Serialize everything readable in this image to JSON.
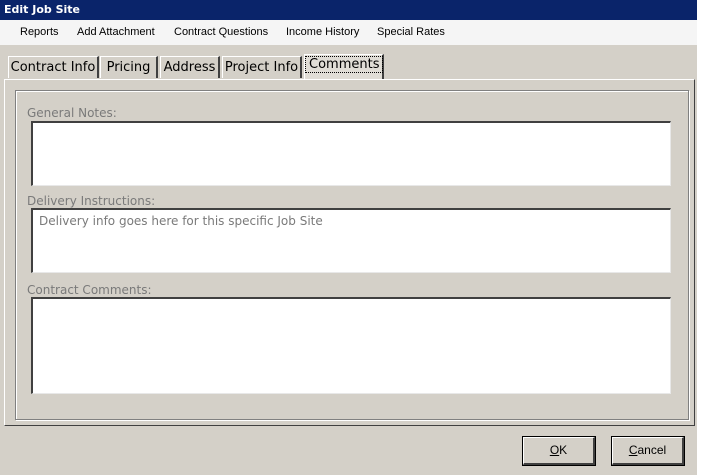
{
  "window": {
    "title": "Edit Job Site"
  },
  "menu": {
    "items": [
      "Reports",
      "Add Attachment",
      "Contract Questions",
      "Income History",
      "Special Rates"
    ]
  },
  "tabs": [
    {
      "label": "Contract Info"
    },
    {
      "label": "Pricing"
    },
    {
      "label": "Address"
    },
    {
      "label": "Project Info"
    },
    {
      "label": "Comments",
      "active": true
    }
  ],
  "form": {
    "general_notes": {
      "label": "General Notes:",
      "value": ""
    },
    "delivery_instructions": {
      "label": "Delivery Instructions:",
      "value": "Delivery info goes here for this specific Job Site"
    },
    "contract_comments": {
      "label": "Contract Comments:",
      "value": ""
    }
  },
  "buttons": {
    "ok": {
      "mnemonic": "O",
      "rest": "K"
    },
    "cancel": {
      "mnemonic": "C",
      "rest": "ancel"
    }
  }
}
